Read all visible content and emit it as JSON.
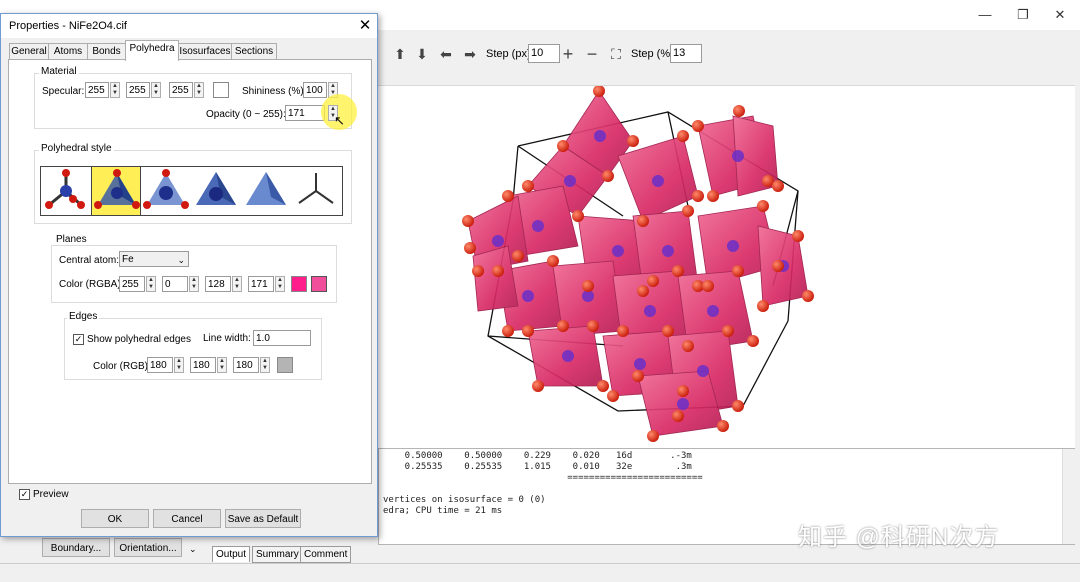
{
  "dialog": {
    "title": "Properties - NiFe2O4.cif",
    "close": "✕",
    "tabs": [
      "General",
      "Atoms",
      "Bonds",
      "Polyhedra",
      "Isosurfaces",
      "Sections"
    ],
    "active_tab": "Polyhedra",
    "material": {
      "group_label": "Material",
      "specular_label": "Specular:",
      "specular": [
        "255",
        "255",
        "255"
      ],
      "shininess_label": "Shininess (%):",
      "shininess": "100",
      "opacity_label": "Opacity (0 ~ 255):",
      "opacity": "171"
    },
    "polyhedral_style": {
      "group_label": "Polyhedral style",
      "selected_index": 1
    },
    "planes": {
      "group_label": "Planes",
      "central_atom_label": "Central atom:",
      "central_atom": "Fe",
      "color_label": "Color (RGBA):",
      "color": [
        "255",
        "0",
        "128",
        "171"
      ],
      "swatch_color": "#ff0080"
    },
    "edges": {
      "group_label": "Edges",
      "show_label": "Show polyhedral edges",
      "line_width_label": "Line width:",
      "line_width": "1.0",
      "color_label": "Color (RGB):",
      "color": [
        "180",
        "180",
        "180"
      ],
      "swatch_color": "#b4b4b4"
    },
    "preview_label": "Preview",
    "ok": "OK",
    "cancel": "Cancel",
    "save_default": "Save as Default"
  },
  "toolbar": {
    "step_px_label": "Step (px):",
    "step_px": "10",
    "step_pct_label": "Step (%):",
    "step_pct": "13"
  },
  "bottom_buttons": {
    "boundary": "Boundary...",
    "orientation": "Orientation..."
  },
  "output": {
    "lines": [
      "    0.50000    0.50000    0.229    0.020   16d       .-3m",
      "    0.25535    0.25535    1.015    0.010   32e        .3m",
      "                                  =========================",
      "",
      "vertices on isosurface = 0 (0)",
      "edra; CPU time = 21 ms"
    ],
    "tabs": [
      "Output",
      "Summary",
      "Comment"
    ]
  },
  "watermark": "知乎 @科研N次方",
  "colors": {
    "polyhedra": "#e8336f",
    "oxygen": "#e02010",
    "cation": "#6a2fc9",
    "frame": "#111111"
  }
}
